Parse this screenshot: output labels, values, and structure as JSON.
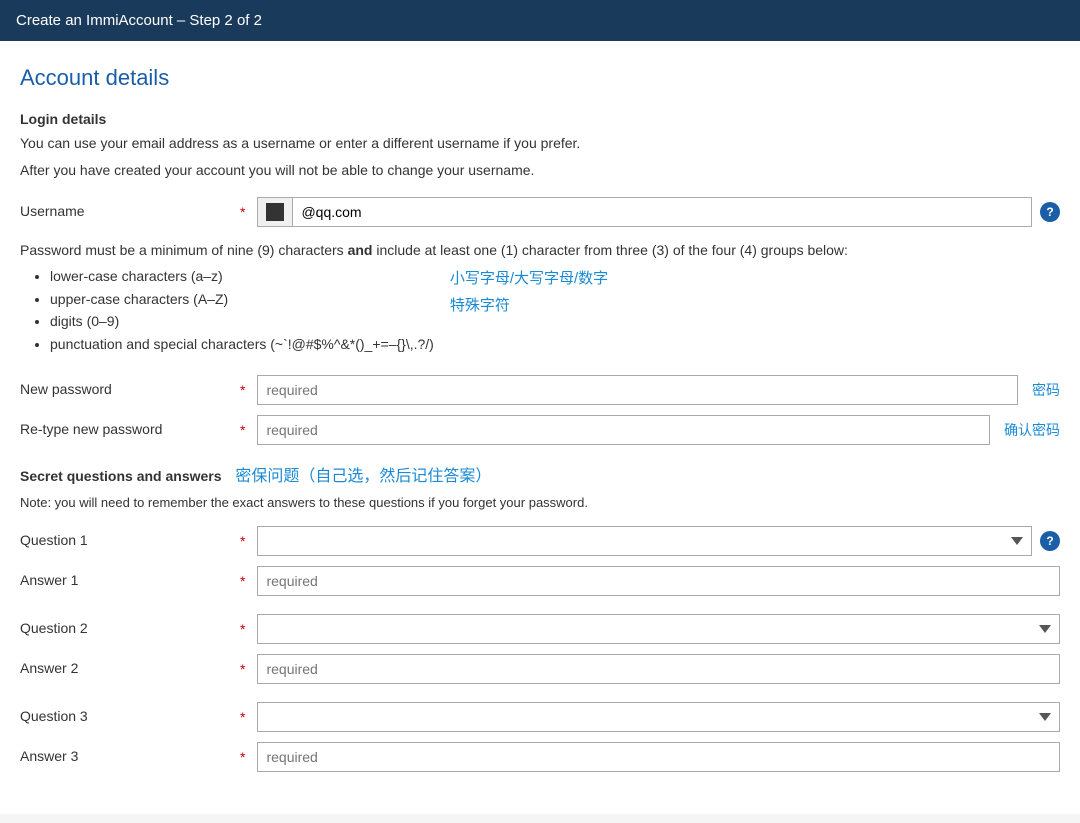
{
  "header": {
    "title": "Create an ImmiAccount – Step 2 of 2"
  },
  "page": {
    "title": "Account details",
    "login_section": {
      "label": "Login details",
      "description1": "You can use your email address as a username or enter a different username if you prefer.",
      "description2": "After you have created your account you will not be able to change your username."
    },
    "username": {
      "label": "Username",
      "value": "@qq.com",
      "required": true
    },
    "password_rules": {
      "intro": "Password must be a minimum of nine (9) characters and include at least one (1) character from three (3) of the four (4) groups below:",
      "rules": [
        "lower-case characters (a–z)",
        "upper-case characters (A–Z)",
        "digits (0–9)",
        "punctuation and special characters (~`!@#$%^&*()_+=–{}\\,.?/)"
      ],
      "chinese_annotation": "小写字母/大写字母/数字\n特殊字符"
    },
    "new_password": {
      "label": "New password",
      "placeholder": "required",
      "chinese_hint": "密码",
      "required": true
    },
    "retype_password": {
      "label": "Re-type new password",
      "placeholder": "required",
      "chinese_hint": "确认密码",
      "required": true
    },
    "secret_section": {
      "label": "Secret questions and answers",
      "chinese_annotation": "密保问题（自己选，然后记住答案）",
      "note": "Note: you will need to remember the exact answers to these questions if you forget your password."
    },
    "questions": [
      {
        "question_label": "Question 1",
        "answer_label": "Answer 1",
        "answer_placeholder": "required"
      },
      {
        "question_label": "Question 2",
        "answer_label": "Answer 2",
        "answer_placeholder": "required"
      },
      {
        "question_label": "Question 3",
        "answer_label": "Answer 3",
        "answer_placeholder": "required"
      }
    ]
  }
}
